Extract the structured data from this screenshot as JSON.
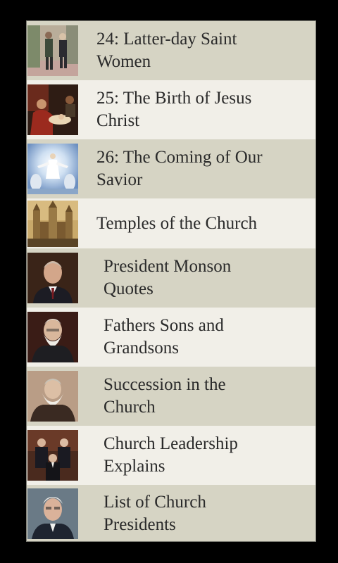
{
  "list": {
    "items": [
      {
        "label": "24: Latter-day Saint Women",
        "line1": "24: Latter-day Saint",
        "line2": "Women",
        "thumb": "women-walking-photo"
      },
      {
        "label": "25: The Birth of Jesus Christ",
        "line1": "25: The Birth of Jesus",
        "line2": "Christ",
        "thumb": "nativity-painting"
      },
      {
        "label": "26: The Coming of Our Savior",
        "line1": "26: The Coming of Our",
        "line2": "Savior",
        "thumb": "second-coming-painting"
      },
      {
        "label": "Temples of the Church",
        "line1": "Temples of the Church",
        "line2": "",
        "thumb": "temple-photo"
      },
      {
        "label": "President Monson Quotes",
        "line1": "President Monson",
        "line2": "Quotes",
        "thumb": "monson-portrait"
      },
      {
        "label": "Fathers Sons and Grandsons",
        "line1": "Fathers Sons and",
        "line2": "Grandsons",
        "thumb": "bearded-man-portrait"
      },
      {
        "label": "Succession in the Church",
        "line1": "Succession in the",
        "line2": "Church",
        "thumb": "brigham-young-portrait"
      },
      {
        "label": "Church Leadership Explains",
        "line1": "Church Leadership",
        "line2": "Explains",
        "thumb": "first-presidency-photo"
      },
      {
        "label": "List of Church Presidents",
        "line1": "List of Church",
        "line2": "Presidents",
        "thumb": "elderly-leader-portrait"
      }
    ]
  },
  "colors": {
    "background": "#000000",
    "row_dark": "#d6d4c4",
    "row_light": "#f1efe8",
    "text": "#2a2a2a",
    "border": "#7a7a72"
  }
}
